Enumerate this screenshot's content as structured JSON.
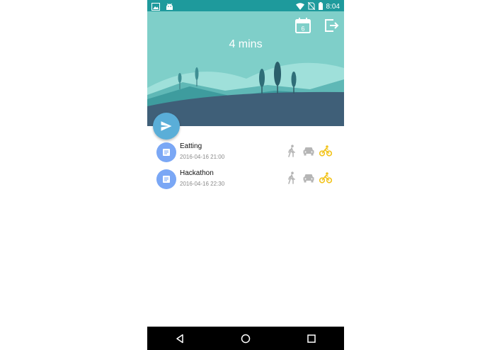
{
  "status_bar": {
    "time": "8:04",
    "icons": [
      "image-icon",
      "android-icon",
      "wifi-icon",
      "no-sim-icon",
      "battery-icon"
    ]
  },
  "header": {
    "duration": "4 mins",
    "calendar_day": "6",
    "actions": [
      "calendar-icon",
      "exit-icon"
    ]
  },
  "fab": {
    "icon": "send-icon"
  },
  "events": [
    {
      "title": "Eatting",
      "datetime": "2016-04-16 21:00",
      "selected_mode": "bike"
    },
    {
      "title": "Hackathon",
      "datetime": "2016-04-16 22:30",
      "selected_mode": "bike"
    }
  ],
  "transport_modes": [
    "walk",
    "car",
    "bike"
  ],
  "nav_bar": {
    "buttons": [
      "back-icon",
      "home-icon",
      "recents-icon"
    ]
  },
  "colors": {
    "status_bar": "#1e9a9c",
    "sky": "#7fcfc9",
    "ground": "#3f5f78",
    "fab": "#5aaed8",
    "avatar": "#7aa7f5",
    "active_mode": "#f2c31b",
    "inactive_mode": "#b5b5b5"
  }
}
